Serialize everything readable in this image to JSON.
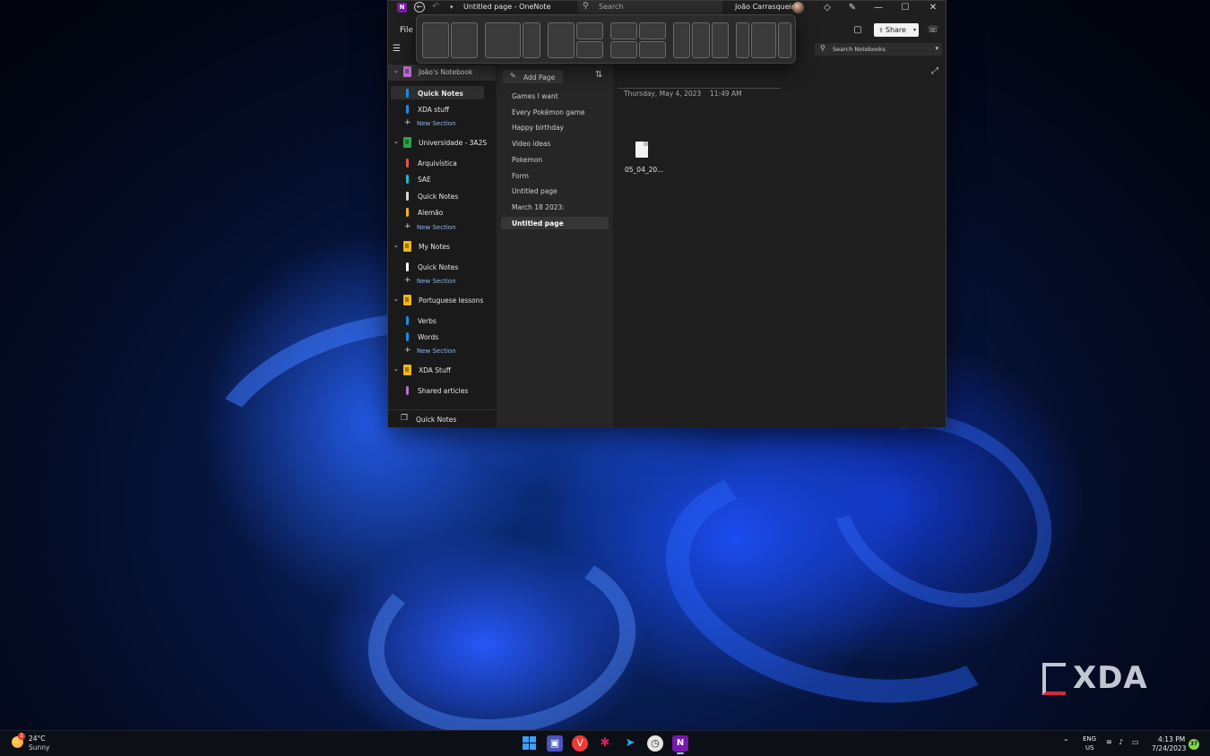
{
  "window": {
    "title": "Untitled page  -  OneNote",
    "search_placeholder": "Search",
    "user_name": "João Carrasqueira",
    "logo_letter": "N",
    "controls": {
      "minimize": "—",
      "maximize": "☐",
      "close": "✕"
    }
  },
  "ribbon": {
    "file_label": "File",
    "share_label": "Share",
    "search_notebooks_placeholder": "Search Notebooks"
  },
  "nav": {
    "notebooks": [
      {
        "name": "João's Notebook",
        "color": "#b86fd0",
        "sections": [
          {
            "name": "Quick Notes",
            "color": "#1e88e5",
            "selected": true
          },
          {
            "name": "XDA stuff",
            "color": "#1e88e5"
          }
        ],
        "new_section": "New Section"
      },
      {
        "name": "Universidade - 3A2S",
        "color": "#2fa34a",
        "sections": [
          {
            "name": "Arquivística",
            "color": "#e0564d"
          },
          {
            "name": "SAE",
            "color": "#29b6c6"
          },
          {
            "name": "Quick Notes",
            "color": "#d6d6d6"
          },
          {
            "name": "Alemão",
            "color": "#f2b61d"
          }
        ],
        "new_section": "New Section"
      },
      {
        "name": "My Notes",
        "color": "#f2b61d",
        "sections": [
          {
            "name": "Quick Notes",
            "color": "#ffffff"
          }
        ],
        "new_section": "New Section"
      },
      {
        "name": "Portuguese lessons",
        "color": "#f2b61d",
        "sections": [
          {
            "name": "Verbs",
            "color": "#1e88e5"
          },
          {
            "name": "Words",
            "color": "#1e88e5"
          }
        ],
        "new_section": "New Section"
      },
      {
        "name": "XDA Stuff",
        "color": "#f2b61d",
        "sections": [
          {
            "name": "Shared articles",
            "color": "#b86fd0"
          }
        ]
      }
    ],
    "footer_label": "Quick Notes"
  },
  "pages": {
    "add_label": "Add Page",
    "items": [
      "Games I want",
      "Every Pokémon game",
      "Happy birthday",
      "Video ideas",
      "Pokemon",
      "Form",
      "Untitled page",
      "March 18 2023:",
      "Untitled page"
    ],
    "selected_index": 8
  },
  "canvas": {
    "date": "Thursday, May 4, 2023",
    "time": "11:49 AM",
    "attachment_name": "05_04_20..."
  },
  "watermark": {
    "text": "XDA"
  },
  "taskbar": {
    "weather_temp": "24°C",
    "weather_cond": "Sunny",
    "weather_badge": "1",
    "lang_line1": "ENG",
    "lang_line2": "US",
    "time": "4:13 PM",
    "date": "7/24/2023",
    "notification_count": "37"
  }
}
